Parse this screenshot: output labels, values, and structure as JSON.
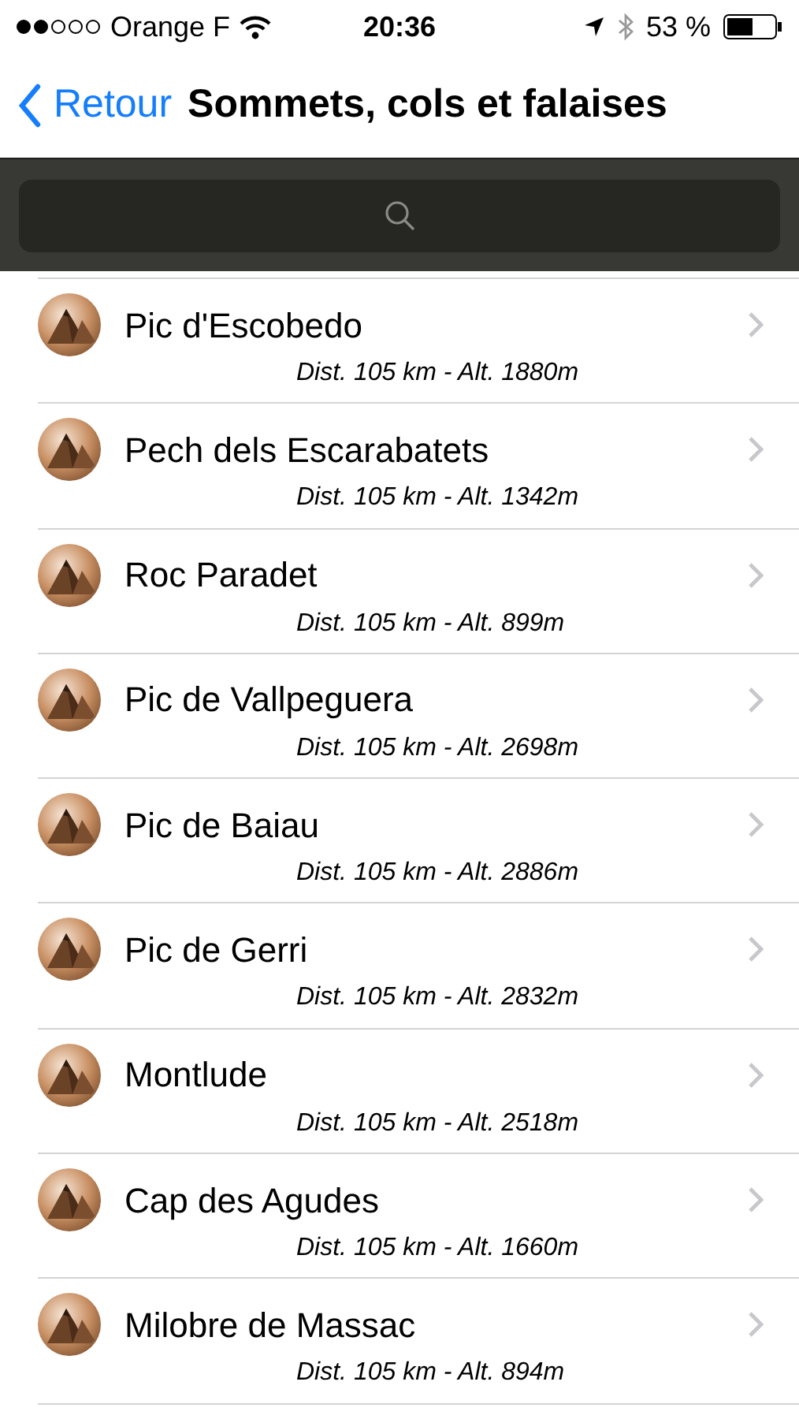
{
  "status_bar": {
    "carrier": "Orange F",
    "time": "20:36",
    "battery": "53 %"
  },
  "nav": {
    "back": "Retour",
    "title": "Sommets, cols et falaises"
  },
  "items": [
    {
      "name": "Pic d'Escobedo",
      "detail": "Dist. 105 km - Alt. 1880m"
    },
    {
      "name": "Pech dels Escarabatets",
      "detail": "Dist. 105 km - Alt. 1342m"
    },
    {
      "name": "Roc Paradet",
      "detail": "Dist. 105 km - Alt. 899m"
    },
    {
      "name": "Pic de Vallpeguera",
      "detail": "Dist. 105 km - Alt. 2698m"
    },
    {
      "name": "Pic de Baiau",
      "detail": "Dist. 105 km - Alt. 2886m"
    },
    {
      "name": "Pic de Gerri",
      "detail": "Dist. 105 km - Alt. 2832m"
    },
    {
      "name": "Montlude",
      "detail": "Dist. 105 km - Alt. 2518m"
    },
    {
      "name": "Cap des Agudes",
      "detail": "Dist. 105 km - Alt. 1660m"
    },
    {
      "name": "Milobre de Massac",
      "detail": "Dist. 105 km - Alt. 894m"
    }
  ]
}
